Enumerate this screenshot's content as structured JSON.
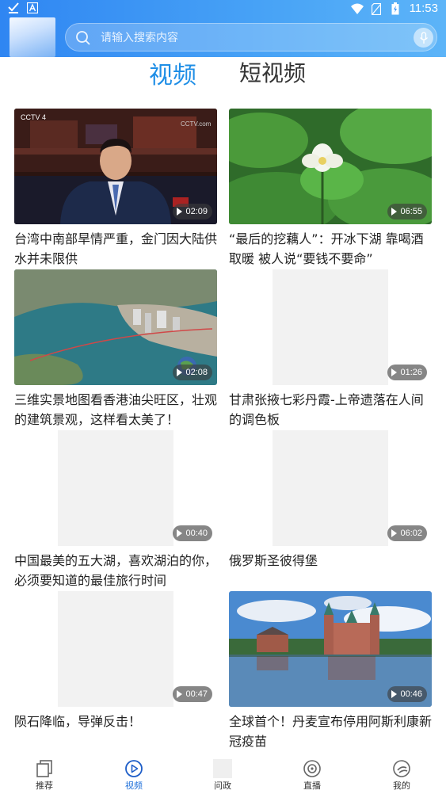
{
  "status_bar": {
    "time": "11:53",
    "left_icons": [
      "check-download-icon",
      "a-app-icon"
    ],
    "right_icons": [
      "wifi-icon",
      "no-sim-icon",
      "battery-icon"
    ]
  },
  "search": {
    "placeholder": "请输入搜索内容"
  },
  "tabs": [
    {
      "label": "视频",
      "active": true
    },
    {
      "label": "短视频",
      "active": false
    }
  ],
  "videos": [
    {
      "title": "台湾中南部旱情严重，金门因大陆供水并未限供",
      "duration": "02:09",
      "thumbnail": "news-anchor"
    },
    {
      "title": "“最后的挖藕人”：开冰下湖 靠喝酒取暖 被人说“要钱不要命”",
      "duration": "06:55",
      "thumbnail": "lotus"
    },
    {
      "title": "三维实景地图看香港油尖旺区，壮观的建筑景观，这样看太美了！",
      "duration": "02:08",
      "thumbnail": "aerial-map"
    },
    {
      "title": "甘肃张掖七彩丹霞-上帝遗落在人间的调色板",
      "duration": "01:26",
      "thumbnail": "placeholder"
    },
    {
      "title": "中国最美的五大湖，喜欢湖泊的你，必须要知道的最佳旅行时间",
      "duration": "00:40",
      "thumbnail": "placeholder"
    },
    {
      "title": "俄罗斯圣彼得堡",
      "duration": "06:02",
      "thumbnail": "placeholder"
    },
    {
      "title": "陨石降临，导弹反击！",
      "duration": "00:47",
      "thumbnail": "placeholder"
    },
    {
      "title": "全球首个！丹麦宣布停用阿斯利康新冠疫苗",
      "duration": "00:46",
      "thumbnail": "castle"
    }
  ],
  "bottom_nav": [
    {
      "label": "推荐",
      "icon": "recommend-icon",
      "active": false
    },
    {
      "label": "视频",
      "icon": "video-play-icon",
      "active": true
    },
    {
      "label": "问政",
      "icon": "inquiry-icon",
      "active": false
    },
    {
      "label": "直播",
      "icon": "live-icon",
      "active": false
    },
    {
      "label": "我的",
      "icon": "profile-icon",
      "active": false
    }
  ],
  "colors": {
    "header_start": "#2f86f2",
    "header_end": "#5cb4f8",
    "tab_active": "#1e8ee6",
    "nav_active": "#1e6fd9"
  }
}
